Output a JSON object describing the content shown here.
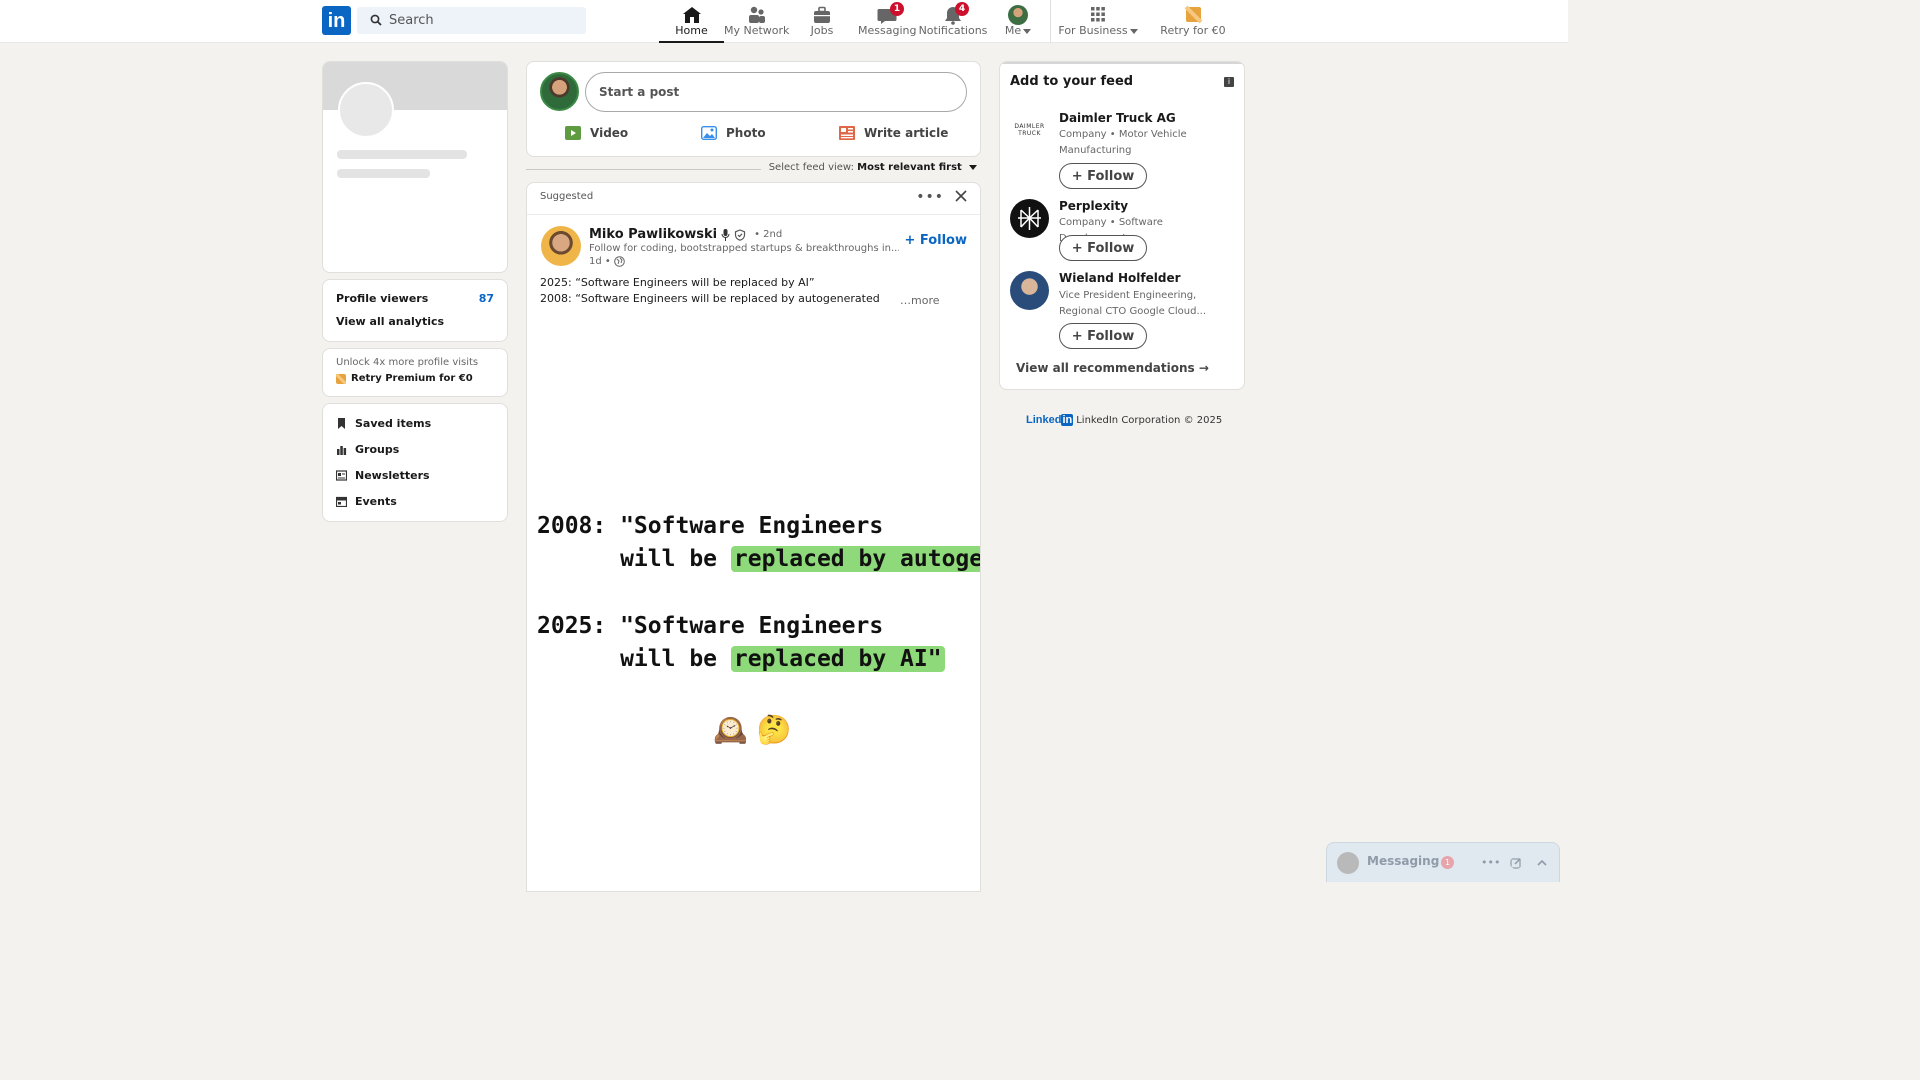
{
  "nav": {
    "logo": "in",
    "search_placeholder": "Search",
    "items": [
      {
        "label": "Home"
      },
      {
        "label": "My Network"
      },
      {
        "label": "Jobs"
      },
      {
        "label": "Messaging",
        "badge": "1"
      },
      {
        "label": "Notifications",
        "badge": "4"
      },
      {
        "label": "Me"
      },
      {
        "label": "For Business"
      },
      {
        "label": "Retry for €0"
      }
    ]
  },
  "left": {
    "profile_viewers_label": "Profile viewers",
    "profile_viewers_count": "87",
    "view_analytics": "View all analytics",
    "premium_teaser": "Unlock 4x more profile visits",
    "premium_cta": "Retry Premium for €0",
    "links": [
      {
        "label": "Saved items",
        "icon": "bookmark-icon"
      },
      {
        "label": "Groups",
        "icon": "groups-icon"
      },
      {
        "label": "Newsletters",
        "icon": "newsletter-icon"
      },
      {
        "label": "Events",
        "icon": "calendar-icon"
      }
    ]
  },
  "composer": {
    "placeholder": "Start a post",
    "video": "Video",
    "photo": "Photo",
    "article": "Write article"
  },
  "feed_sort": {
    "label": "Select feed view:",
    "value": "Most relevant first"
  },
  "post": {
    "header": "Suggested",
    "author": "Miko Pawlikowski",
    "degree": "• 2nd",
    "bio": "Follow for coding, bootstrapped startups & breakthroughs in...",
    "time": "1d •",
    "follow": "+ Follow",
    "line1": "2025: “Software Engineers will be replaced by AI”",
    "line2": "2008: “Software Engineers will be replaced by autogenerated",
    "see_more": "…more",
    "meme": {
      "a_prefix": "2008: \"Software Engineers",
      "a_mid": "      will be ",
      "a_hl": "replaced by autogen\"",
      "b_prefix": "2025: \"Software Engineers",
      "b_mid": "      will be ",
      "b_hl": "replaced by AI\"",
      "emoji": "🕰️ 🤔"
    }
  },
  "right": {
    "title": "Add to your feed",
    "recs": [
      {
        "name": "Daimler Truck AG",
        "desc": "Company • Motor Vehicle Manufacturing",
        "logo_text": "DAIMLER TRUCK"
      },
      {
        "name": "Perplexity",
        "desc": "Company • Software Development"
      },
      {
        "name": "Wieland Holfelder",
        "desc": "Vice President Engineering, Regional CTO Google Cloud..."
      }
    ],
    "follow_label": "+ Follow",
    "view_all": "View all recommendations →"
  },
  "footer": {
    "brand_a": "Linked",
    "brand_b": "in",
    "text": "LinkedIn Corporation © 2025"
  },
  "messaging": {
    "title": "Messaging",
    "badge": "1"
  },
  "colors": {
    "brand": "#0a66c2",
    "badge": "#cb112d",
    "highlight": "#8ed97a"
  }
}
